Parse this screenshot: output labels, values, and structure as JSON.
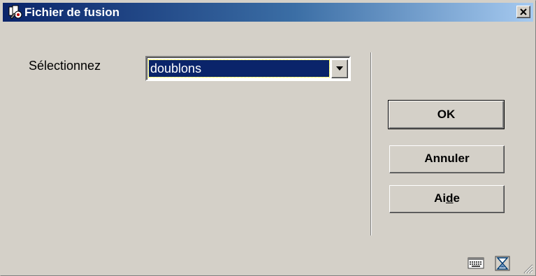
{
  "window": {
    "title": "Fichier de fusion",
    "close_icon": "close-icon"
  },
  "form": {
    "select_label": "Sélectionnez",
    "select_value": "doublons"
  },
  "buttons": {
    "ok": "OK",
    "cancel": "Annuler",
    "help_prefix": "Ai",
    "help_mnemonic": "d",
    "help_suffix": "e"
  },
  "colors": {
    "title_gradient_start": "#0a246a",
    "title_gradient_end": "#a6caf0",
    "dialog_background": "#d4d0c8",
    "selection_background": "#0a246a"
  },
  "status_icons": [
    "keyboard-icon",
    "hourglass-icon",
    "resize-grip-icon"
  ]
}
